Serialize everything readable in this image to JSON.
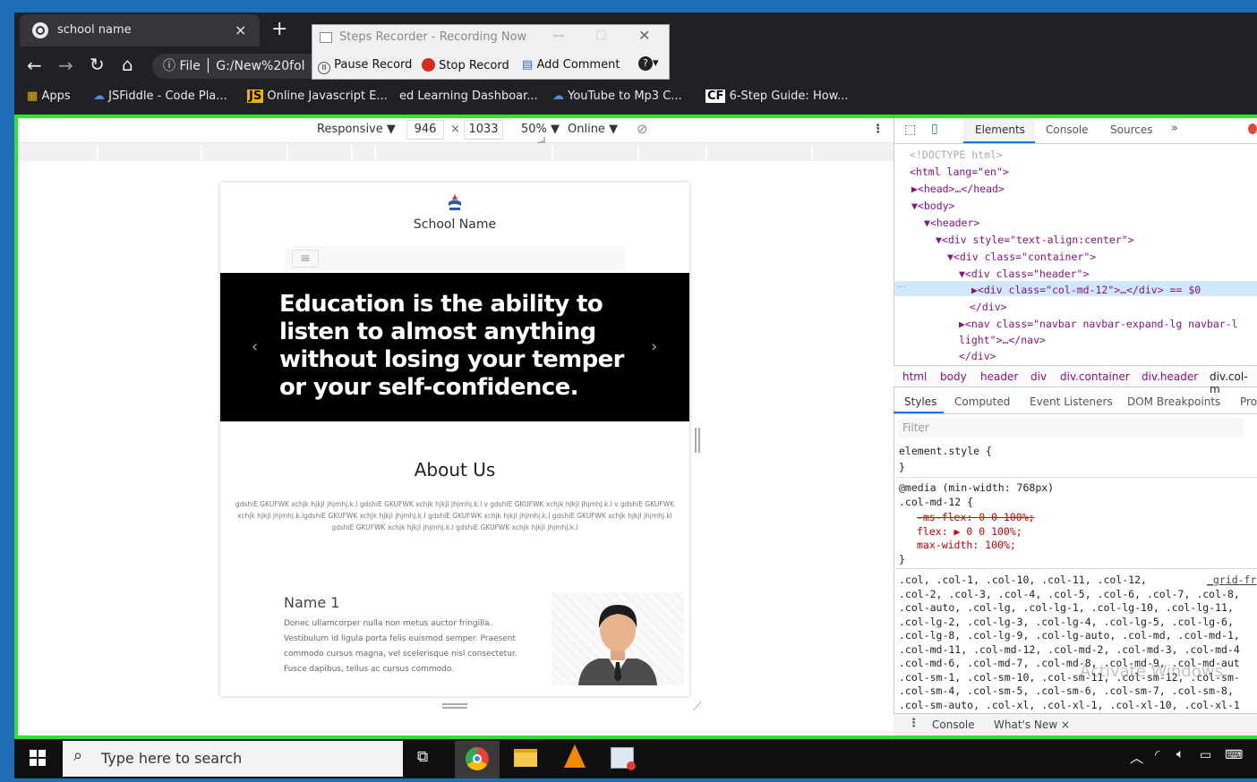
{
  "browser": {
    "tab_title": "school name",
    "tab_close": "×",
    "new_tab": "+",
    "address_file": "File",
    "address_path": "G:/New%20fol",
    "bookmarks": [
      "Apps",
      "JSFiddle - Code Pla...",
      "Online Javascript E...",
      "Learning Dashboar...",
      "YouTube to Mp3 C...",
      "6-Step Guide: How..."
    ]
  },
  "steps_recorder": {
    "title": "Steps Recorder - Recording Now",
    "pause": "Pause Record",
    "stop": "Stop Record",
    "comment": "Add Comment"
  },
  "device_toolbar": {
    "mode": "Responsive ▼",
    "width": "946",
    "x": "×",
    "height": "1033",
    "zoom": "50% ▼",
    "network": "Online ▼"
  },
  "site": {
    "brand": "School Name",
    "hero": "Education is the ability to listen to almost anything without losing your temper or your self-confidence.",
    "about_title": "About Us",
    "about_text": "gdshiE GKUFWK xchjk hjkjl jhjmhj.k.l gdshiE GKUFWK xchjk hjkjl jhjmhj.k.l v gdshiE GKUFWK xchjk hjkjl jhjmhj.k.l v gdshiE GKUFWK xchjk hjkjl jhjmhj.k.lgdshiE GKUFWK xchjk hjkjl jhjmhj.k.l gdshiE GKUFWK xchjk hjkjl jhjmhj.k.l gdshiE GKUFWK xchjk hjkjl jhjmhj.kl gdshiE GKUFWK xchjk hjkjl jhjmhj.k.l gdshiE GKUFWK xchjk hjkjl jhjmhj.k.l",
    "person_name": "Name 1",
    "person_text": "Donec ullamcorper nulla non metus auctor fringilla. Vestibulum id ligula porta felis euismod semper. Praesent commodo cursus magna, vel scelerisque nisl consectetur. Fusce dapibus, tellus ac cursus commodo."
  },
  "devtools": {
    "tabs": [
      "Elements",
      "Console",
      "Sources",
      "»"
    ],
    "dom": [
      "<!DOCTYPE html>",
      "<html lang=\"en\">",
      "▶<head>…</head>",
      "▼<body>",
      "▼<header>",
      "▼<div style=\"text-align:center\">",
      "▼<div class=\"container\">",
      "▼<div class=\"header\">",
      "▶<div class=\"col-md-12\">…</div> == $0",
      "</div>",
      "▶<nav class=\"navbar navbar-expand-lg navbar-l",
      "light\">…</nav>",
      "</div>"
    ],
    "breadcrumbs": [
      "html",
      "body",
      "header",
      "div",
      "div.container",
      "div.header",
      "div.col-m"
    ],
    "style_tabs": [
      "Styles",
      "Computed",
      "Event Listeners",
      "DOM Breakpoints",
      "Pro"
    ],
    "filter": "Filter",
    "styles": [
      "element.style {",
      "}",
      "@media (min-width: 768px)",
      ".col-md-12 {",
      "-ms-flex: 0 0 100%;",
      "flex: ▶ 0 0 100%;",
      "max-width: 100%;",
      "}",
      ".col, .col-1, .col-10, .col-11, .col-12,",
      ".col-2, .col-3, .col-4, .col-5, .col-6, .col-7, .col-8,",
      ".col-auto, .col-lg, .col-lg-1, .col-lg-10, .col-lg-11,",
      ".col-lg-2, .col-lg-3, .col-lg-4, .col-lg-5, .col-lg-6,",
      ".col-lg-8, .col-lg-9, .col-lg-auto, .col-md, .col-md-1,",
      ".col-md-11, .col-md-12, .col-md-2, .col-md-3, .col-md-4",
      ".col-md-6, .col-md-7, .col-md-8, .col-md-9, .col-md-aut",
      ".col-sm-1, .col-sm-10, .col-sm-11, .col-sm-12, .col-sm-",
      ".col-sm-4, .col-sm-5, .col-sm-6, .col-sm-7, .col-sm-8,",
      ".col-sm-auto, .col-xl, .col-xl-1, .col-xl-10, .col-xl-1"
    ],
    "grid_link": "_grid-fr",
    "drawer": [
      "Console",
      "What's New ×"
    ],
    "watermark": "Activate Windows"
  },
  "taskbar": {
    "search": "Type here to search"
  }
}
